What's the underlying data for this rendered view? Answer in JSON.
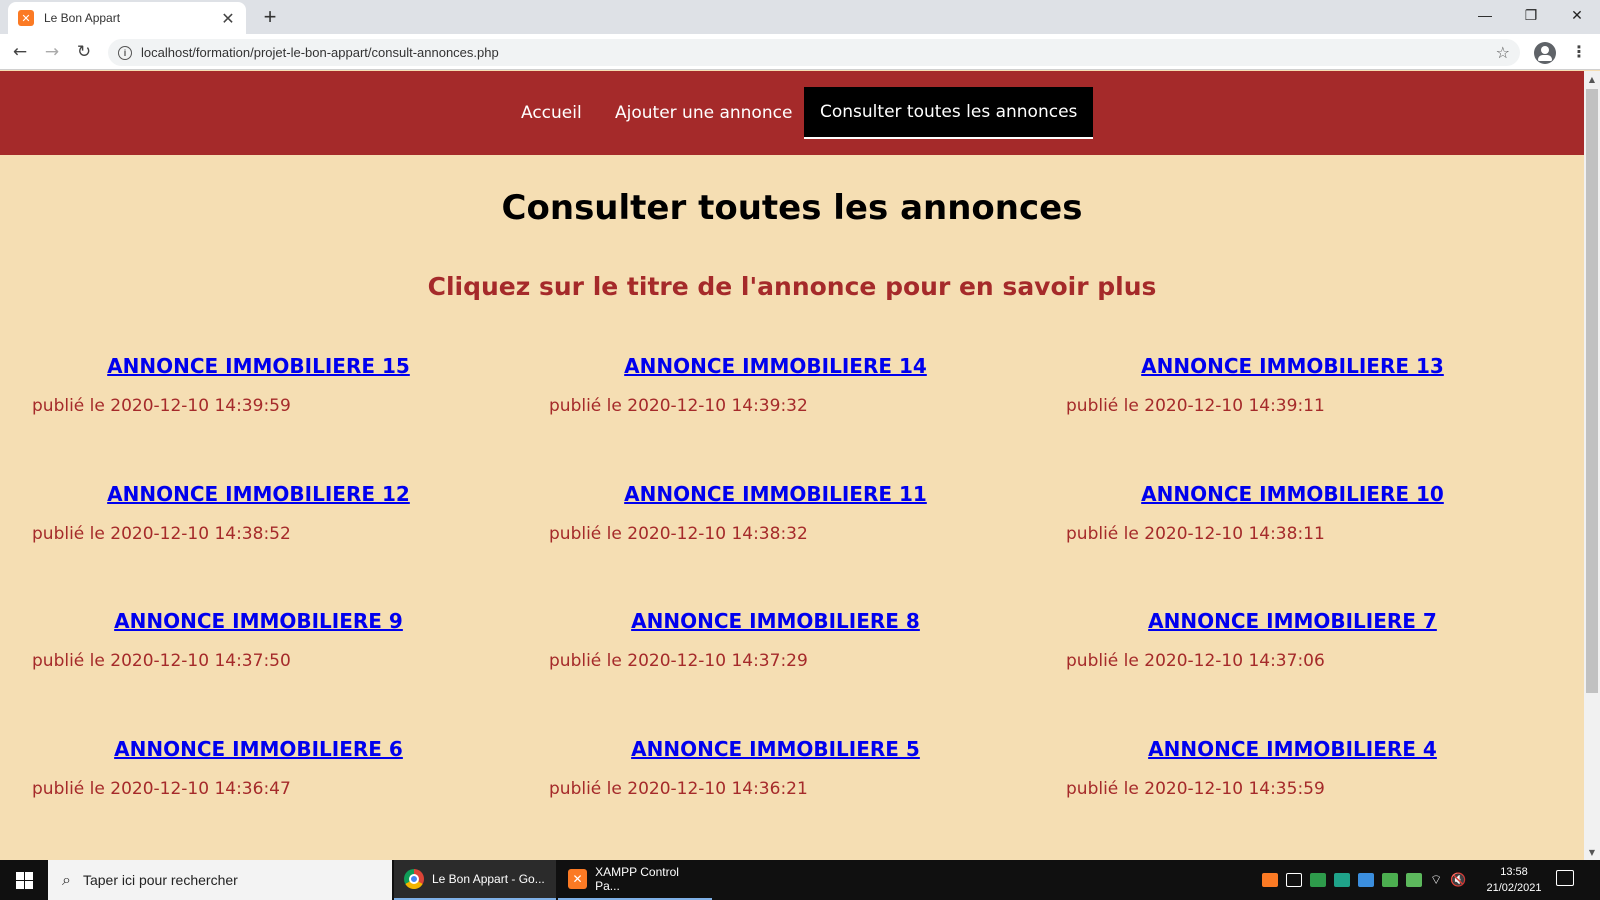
{
  "browser": {
    "tab_title": "Le Bon Appart",
    "url": "localhost/formation/projet-le-bon-appart/consult-annonces.php"
  },
  "nav": {
    "items": [
      {
        "label": "Accueil"
      },
      {
        "label": "Ajouter une annonce"
      },
      {
        "label": "Consulter toutes les annonces"
      }
    ]
  },
  "main": {
    "title": "Consulter toutes les annonces",
    "subtitle": "Cliquez sur le titre de l'annonce pour en savoir plus",
    "listings": [
      {
        "title": "ANNONCE IMMOBILIERE 15",
        "date": "publié le 2020-12-10 14:39:59"
      },
      {
        "title": "ANNONCE IMMOBILIERE 14",
        "date": "publié le 2020-12-10 14:39:32"
      },
      {
        "title": "ANNONCE IMMOBILIERE 13",
        "date": "publié le 2020-12-10 14:39:11"
      },
      {
        "title": "ANNONCE IMMOBILIERE 12",
        "date": "publié le 2020-12-10 14:38:52"
      },
      {
        "title": "ANNONCE IMMOBILIERE 11",
        "date": "publié le 2020-12-10 14:38:32"
      },
      {
        "title": "ANNONCE IMMOBILIERE 10",
        "date": "publié le 2020-12-10 14:38:11"
      },
      {
        "title": "ANNONCE IMMOBILIERE 9",
        "date": "publié le 2020-12-10 14:37:50"
      },
      {
        "title": "ANNONCE IMMOBILIERE 8",
        "date": "publié le 2020-12-10 14:37:29"
      },
      {
        "title": "ANNONCE IMMOBILIERE 7",
        "date": "publié le 2020-12-10 14:37:06"
      },
      {
        "title": "ANNONCE IMMOBILIERE 6",
        "date": "publié le 2020-12-10 14:36:47"
      },
      {
        "title": "ANNONCE IMMOBILIERE 5",
        "date": "publié le 2020-12-10 14:36:21"
      },
      {
        "title": "ANNONCE IMMOBILIERE 4",
        "date": "publié le 2020-12-10 14:35:59"
      }
    ]
  },
  "taskbar": {
    "search_placeholder": "Taper ici pour rechercher",
    "apps": [
      {
        "label": "Le Bon Appart - Go..."
      },
      {
        "label": "XAMPP Control Pa..."
      }
    ],
    "time": "13:58",
    "date": "21/02/2021"
  },
  "colors": {
    "page_background": "#f5deb3",
    "nav_background": "#a52a2a",
    "link": "#0000ee",
    "accent_text": "#a52a2a"
  }
}
